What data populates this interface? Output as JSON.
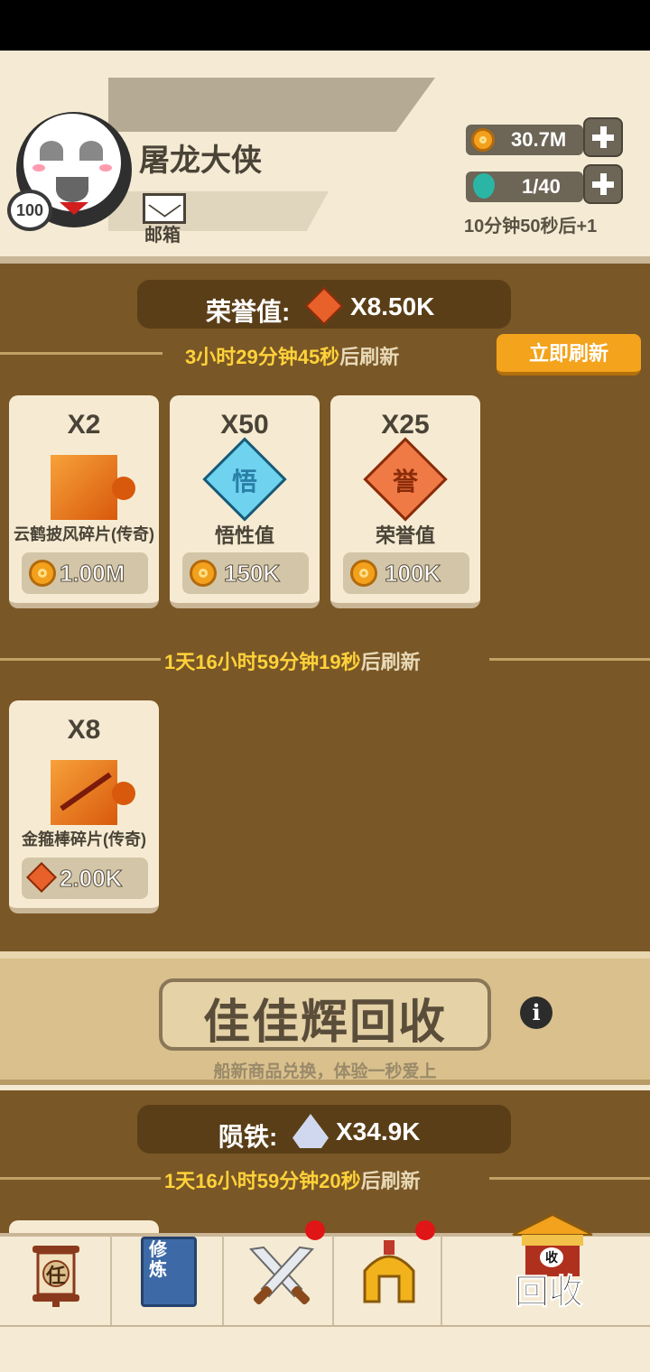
{
  "player": {
    "name": "屠龙大侠",
    "level": "100",
    "mail_label": "邮箱"
  },
  "resources": {
    "coins": "30.7M",
    "energy": "1/40",
    "energy_timer": "10分钟50秒后+1"
  },
  "honor_shop": {
    "currency_label": "荣誉值:",
    "currency_amount": "X8.50K",
    "refresh_prefix": "3小时29分钟45秒",
    "refresh_suffix": "后刷新",
    "refresh_now": "立即刷新",
    "items": [
      {
        "qty": "X2",
        "name": "云鹤披风碎片(传奇)",
        "price": "1.00M",
        "price_currency": "coin-icon"
      },
      {
        "qty": "X50",
        "name": "悟性值",
        "icon_char": "悟",
        "price": "150K",
        "price_currency": "coin-icon"
      },
      {
        "qty": "X25",
        "name": "荣誉值",
        "icon_char": "誉",
        "price": "100K",
        "price_currency": "coin-icon"
      }
    ]
  },
  "daily_shop": {
    "refresh_prefix": "1天16小时59分钟19秒",
    "refresh_suffix": "后刷新",
    "items": [
      {
        "qty": "X8",
        "name": "金箍棒碎片(传奇)",
        "price": "2.00K",
        "price_currency": "honor-icon"
      }
    ]
  },
  "recycle": {
    "title": "佳佳辉回收",
    "subtitle": "船新商品兑换，体验一秒爱上",
    "info": "i"
  },
  "meteor_shop": {
    "currency_label": "陨铁:",
    "currency_amount": "X34.9K",
    "refresh_prefix": "1天16小时59分钟20秒",
    "refresh_suffix": "后刷新"
  },
  "nav": {
    "task_char": "任",
    "train_label": "修炼",
    "recycle_small": "收",
    "recycle_label": "回收"
  },
  "colors": {
    "gold_text": "#ffd23a",
    "panel_brown": "#7a5726",
    "accent_orange": "#f3a31c",
    "badge_red": "#e01515"
  }
}
